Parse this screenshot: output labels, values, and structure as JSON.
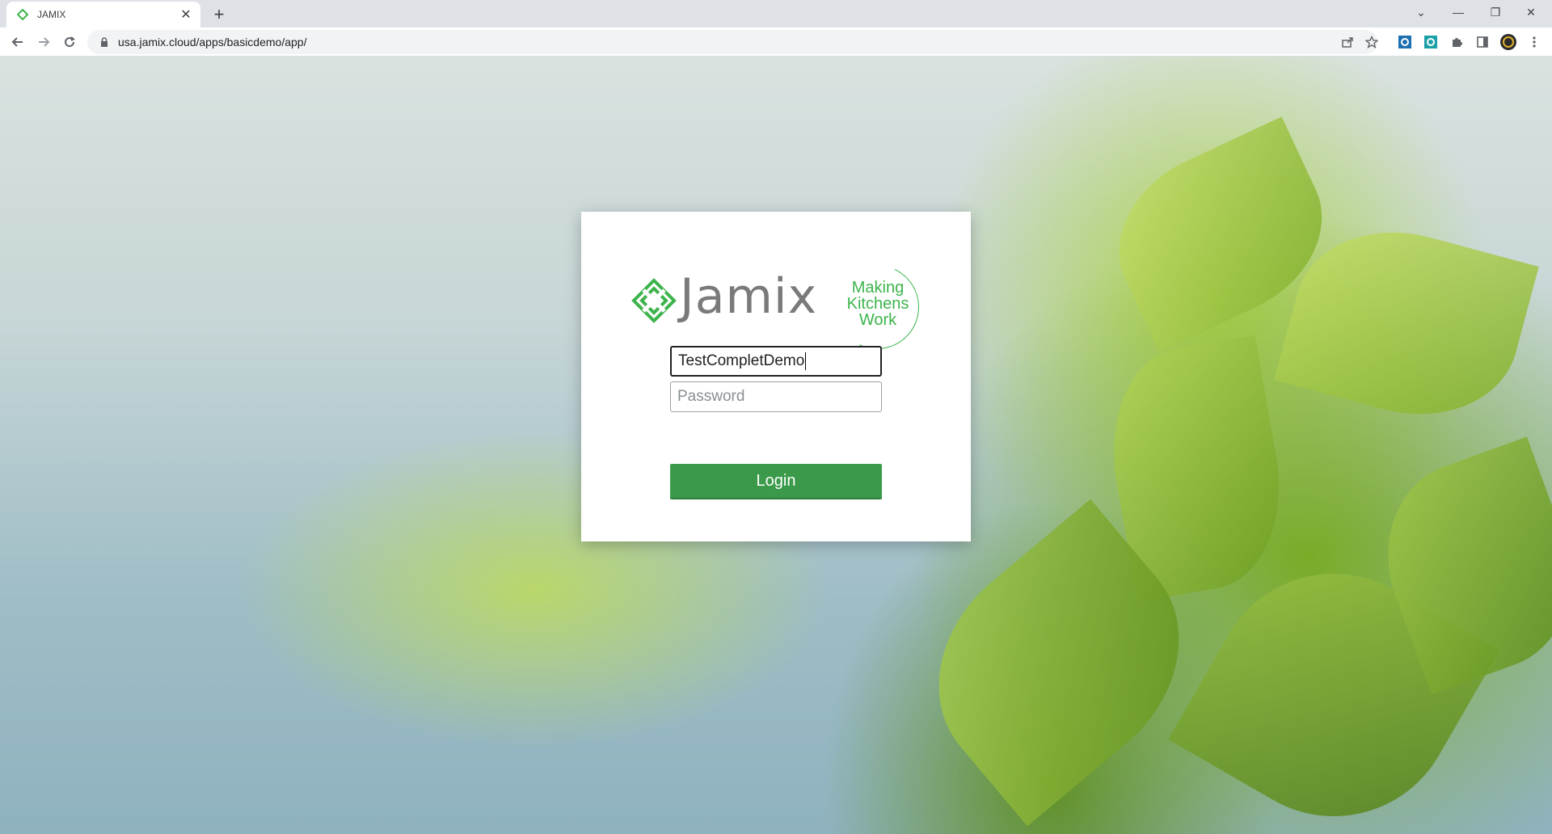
{
  "browser": {
    "tab": {
      "title": "JAMIX",
      "favicon": "jamix-logo-icon"
    },
    "new_tab_label": "+",
    "url": "usa.jamix.cloud/apps/basicdemo/app/",
    "window_controls": [
      "chevron-down-icon",
      "minimize-icon",
      "restore-icon",
      "close-icon"
    ],
    "toolbar_icons": [
      "back-icon",
      "forward-icon",
      "reload-icon"
    ],
    "omnibox_icons": [
      "share-icon",
      "bookmark-star-icon"
    ],
    "extension_icons": [
      "extension-1-icon",
      "extension-2-icon",
      "puzzle-icon",
      "side-panel-icon",
      "profile-avatar-icon",
      "menu-dots-icon"
    ]
  },
  "login": {
    "logo": {
      "wordmark": "Jamix",
      "tagline_lines": [
        "Making",
        "Kitchens",
        "Work"
      ]
    },
    "username": {
      "value": "TestCompletDemo"
    },
    "password": {
      "placeholder": "Password",
      "value": ""
    },
    "login_button": "Login"
  },
  "colors": {
    "brand_green": "#3cb44b",
    "button_green": "#3a9a4a",
    "wordmark_gray": "#7a7a7a"
  }
}
